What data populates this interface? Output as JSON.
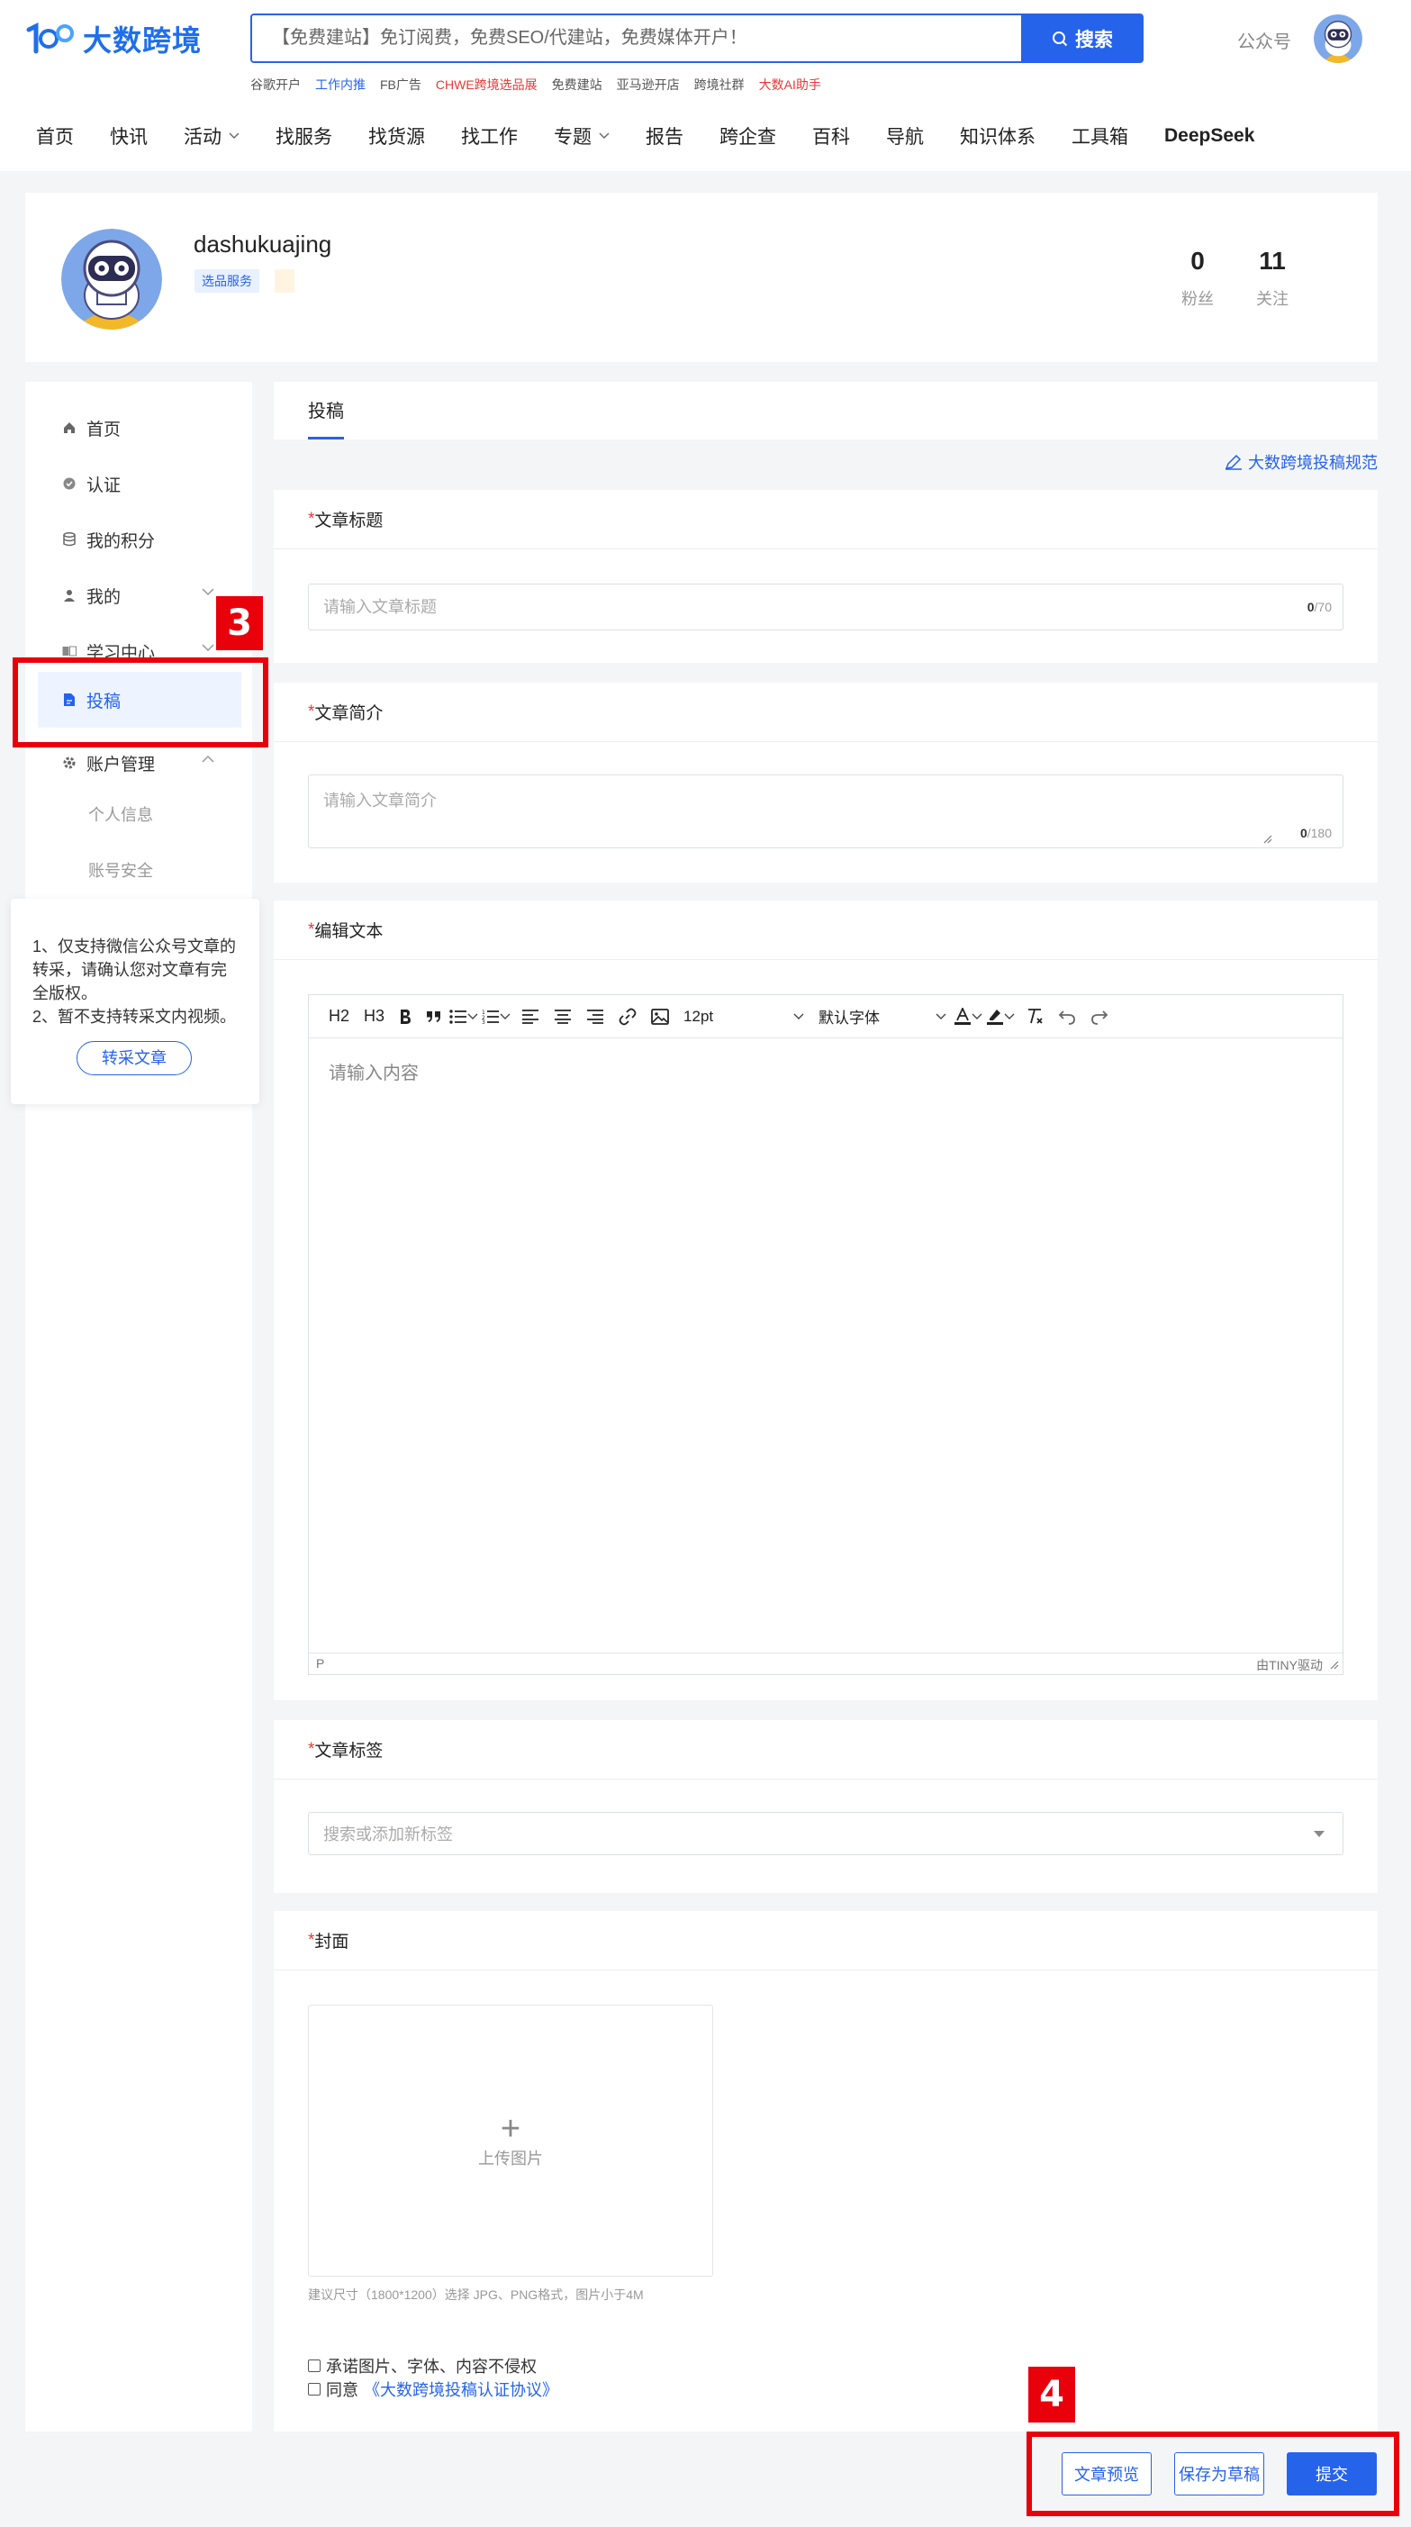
{
  "header": {
    "logo_mark": "100",
    "logo_text": "大数跨境",
    "search_placeholder": "【免费建站】免订阅费，免费SEO/代建站，免费媒体开户！",
    "search_button": "搜索",
    "hotlinks": [
      {
        "label": "谷歌开户",
        "tone": "normal"
      },
      {
        "label": "工作内推",
        "tone": "blue"
      },
      {
        "label": "FB广告",
        "tone": "normal"
      },
      {
        "label": "CHWE跨境选品展",
        "tone": "red"
      },
      {
        "label": "免费建站",
        "tone": "normal"
      },
      {
        "label": "亚马逊开店",
        "tone": "normal"
      },
      {
        "label": "跨境社群",
        "tone": "normal"
      },
      {
        "label": "大数AI助手",
        "tone": "red"
      }
    ],
    "gzh": "公众号",
    "nav": [
      {
        "label": "首页",
        "dropdown": false
      },
      {
        "label": "快讯",
        "dropdown": false
      },
      {
        "label": "活动",
        "dropdown": true
      },
      {
        "label": "找服务",
        "dropdown": false
      },
      {
        "label": "找货源",
        "dropdown": false
      },
      {
        "label": "找工作",
        "dropdown": false
      },
      {
        "label": "专题",
        "dropdown": true
      },
      {
        "label": "报告",
        "dropdown": false
      },
      {
        "label": "跨企查",
        "dropdown": false
      },
      {
        "label": "百科",
        "dropdown": false
      },
      {
        "label": "导航",
        "dropdown": false
      },
      {
        "label": "知识体系",
        "dropdown": false
      },
      {
        "label": "工具箱",
        "dropdown": false
      },
      {
        "label": "DeepSeek",
        "dropdown": false
      }
    ]
  },
  "profile": {
    "username": "dashukuajing",
    "tag": "选品服务",
    "fans_count": "0",
    "fans_label": "粉丝",
    "follow_count": "11",
    "follow_label": "关注"
  },
  "sidebar": {
    "items": [
      {
        "label": "首页",
        "icon": "home-icon"
      },
      {
        "label": "认证",
        "icon": "verified-icon"
      },
      {
        "label": "我的积分",
        "icon": "database-icon"
      },
      {
        "label": "我的",
        "icon": "user-icon"
      },
      {
        "label": "学习中心",
        "icon": "book-icon"
      },
      {
        "label": "投稿",
        "icon": "document-icon"
      },
      {
        "label": "账户管理",
        "icon": "gear-icon"
      }
    ],
    "subitems": [
      "个人信息",
      "账号安全"
    ],
    "tip_lines": [
      "1、仅支持微信公众号文章的",
      "转采，请确认您对文章有完",
      "全版权。",
      "2、暂不支持转采文内视频。"
    ],
    "tip_button": "转采文章"
  },
  "annotations": {
    "badge3": "3",
    "badge4": "4"
  },
  "main": {
    "tab": "投稿",
    "rules_link": "大数跨境投稿规范",
    "title_label": "文章标题",
    "title_placeholder": "请输入文章标题",
    "title_count": "0",
    "title_max": "/70",
    "summary_label": "文章简介",
    "summary_placeholder": "请输入文章简介",
    "summary_count": "0",
    "summary_max": "/180",
    "editor_label": "编辑文本",
    "editor": {
      "h2": "H2",
      "h3": "H3",
      "font_size": "12pt",
      "font_family": "默认字体",
      "placeholder": "请输入内容",
      "status_path": "P",
      "powered": "由TINY驱动"
    },
    "tags_label": "文章标签",
    "tags_placeholder": "搜索或添加新标签",
    "cover_label": "封面",
    "upload_label": "上传图片",
    "cover_hint": "建议尺寸（1800*1200）选择 JPG、PNG格式，图片小于4M",
    "agree1": "承诺图片、字体、内容不侵权",
    "agree2_prefix": "同意",
    "agree2_link": "《大数跨境投稿认证协议》"
  },
  "actions": {
    "preview": "文章预览",
    "draft": "保存为草稿",
    "submit": "提交"
  },
  "colors": {
    "accent": "#2563eb",
    "annotation_red": "#e8000b",
    "required": "#e53935"
  }
}
